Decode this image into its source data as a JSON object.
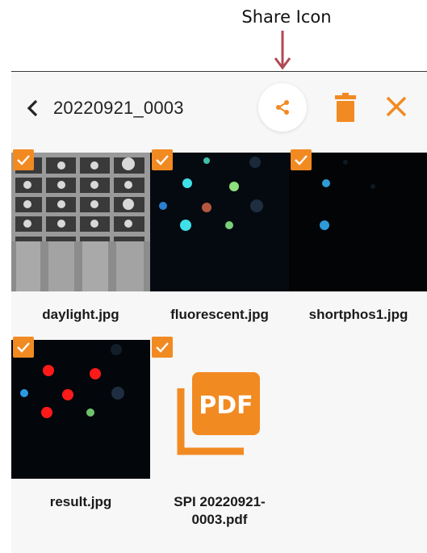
{
  "annotation": {
    "label": "Share Icon"
  },
  "toolbar": {
    "folder_name": "20220921_0003"
  },
  "colors": {
    "accent": "#f28a22",
    "annotation_arrow": "#b04a55",
    "toolbar_bg": "#f7f7f7"
  },
  "icons": {
    "back": "chevron-left-icon",
    "share": "share-icon",
    "delete": "trash-icon",
    "close": "close-icon",
    "check": "checkmark-icon",
    "pdf": "pdf-file-icon"
  },
  "files": [
    {
      "name": "daylight.jpg",
      "selected": true
    },
    {
      "name": "fluorescent.jpg",
      "selected": true
    },
    {
      "name": "shortphos1.jpg",
      "selected": true
    },
    {
      "name": "result.jpg",
      "selected": true
    },
    {
      "name": "SPI 20220921-0003.pdf",
      "selected": true,
      "pdf_label": "PDF"
    }
  ]
}
